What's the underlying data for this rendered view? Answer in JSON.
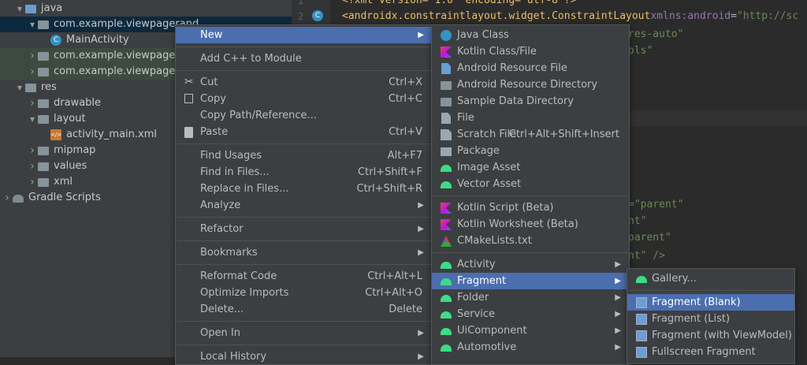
{
  "tree": [
    {
      "label": "java",
      "level": 1,
      "state": "open",
      "icon": "folder-blue",
      "row": "normal"
    },
    {
      "label": "com.example.viewpagerand...",
      "level": 2,
      "state": "open",
      "icon": "folder",
      "row": "selected"
    },
    {
      "label": "MainActivity",
      "level": 3,
      "state": "leaf",
      "icon": "class",
      "row": "normal"
    },
    {
      "label": "com.example.viewpagerand",
      "level": 2,
      "state": "closed",
      "icon": "folder",
      "row": "highlight"
    },
    {
      "label": "com.example.viewpagerand",
      "level": 2,
      "state": "closed",
      "icon": "folder",
      "row": "highlight"
    },
    {
      "label": "res",
      "level": 1,
      "state": "open",
      "icon": "folder",
      "row": "normal"
    },
    {
      "label": "drawable",
      "level": 2,
      "state": "closed",
      "icon": "folder",
      "row": "normal"
    },
    {
      "label": "layout",
      "level": 2,
      "state": "open",
      "icon": "folder",
      "row": "normal"
    },
    {
      "label": "activity_main.xml",
      "level": 3,
      "state": "leaf",
      "icon": "xml",
      "row": "normal"
    },
    {
      "label": "mipmap",
      "level": 2,
      "state": "closed",
      "icon": "folder",
      "row": "normal"
    },
    {
      "label": "values",
      "level": 2,
      "state": "closed",
      "icon": "folder",
      "row": "normal"
    },
    {
      "label": "xml",
      "level": 2,
      "state": "closed",
      "icon": "folder",
      "row": "normal"
    },
    {
      "label": "Gradle Scripts",
      "level": 0,
      "state": "closed",
      "icon": "gradle",
      "row": "normal"
    }
  ],
  "editor": {
    "line_numbers": [
      "1",
      "2"
    ],
    "line1": "<?xml version=\"1.0\" encoding=\"utf-8\"?>",
    "line2_tag": "<androidx.constraintlayout.widget.ConstraintLayout",
    "line2_attr_ns": "xmlns:",
    "line2_attr_name": "android",
    "line2_eq": "=",
    "line2_val": "\"http://sc",
    "line3": "res-auto\"",
    "line4": "ols\"",
    "line_a": "=\"parent\"",
    "line_b": "nt\"",
    "line_c": "parent\"",
    "line_d": "nt\" />"
  },
  "context_menu": {
    "items": [
      {
        "label": "New",
        "shortcut": "",
        "submenu": true,
        "active": true,
        "icon": ""
      },
      {
        "sep": true
      },
      {
        "label": "Add C++ to Module",
        "shortcut": "",
        "submenu": false,
        "icon": ""
      },
      {
        "sep": true
      },
      {
        "label": "Cut",
        "shortcut": "Ctrl+X",
        "submenu": false,
        "icon": "scissors-icon"
      },
      {
        "label": "Copy",
        "shortcut": "Ctrl+C",
        "submenu": false,
        "icon": "copy-icon"
      },
      {
        "label": "Copy Path/Reference...",
        "shortcut": "",
        "submenu": false,
        "icon": ""
      },
      {
        "label": "Paste",
        "shortcut": "Ctrl+V",
        "submenu": false,
        "icon": "clipboard-icon"
      },
      {
        "sep": true
      },
      {
        "label": "Find Usages",
        "shortcut": "Alt+F7",
        "submenu": false,
        "icon": ""
      },
      {
        "label": "Find in Files...",
        "shortcut": "Ctrl+Shift+F",
        "submenu": false,
        "icon": ""
      },
      {
        "label": "Replace in Files...",
        "shortcut": "Ctrl+Shift+R",
        "submenu": false,
        "icon": ""
      },
      {
        "label": "Analyze",
        "shortcut": "",
        "submenu": true,
        "icon": ""
      },
      {
        "sep": true
      },
      {
        "label": "Refactor",
        "shortcut": "",
        "submenu": true,
        "icon": ""
      },
      {
        "sep": true
      },
      {
        "label": "Bookmarks",
        "shortcut": "",
        "submenu": true,
        "icon": ""
      },
      {
        "sep": true
      },
      {
        "label": "Reformat Code",
        "shortcut": "Ctrl+Alt+L",
        "submenu": false,
        "icon": ""
      },
      {
        "label": "Optimize Imports",
        "shortcut": "Ctrl+Alt+O",
        "submenu": false,
        "icon": ""
      },
      {
        "label": "Delete...",
        "shortcut": "Delete",
        "submenu": false,
        "icon": ""
      },
      {
        "sep": true
      },
      {
        "label": "Open In",
        "shortcut": "",
        "submenu": true,
        "icon": ""
      },
      {
        "sep": true
      },
      {
        "label": "Local History",
        "shortcut": "",
        "submenu": true,
        "icon": ""
      }
    ]
  },
  "new_menu": {
    "items": [
      {
        "label": "Java Class",
        "shortcut": "",
        "submenu": false,
        "icon": "java-class-icon"
      },
      {
        "label": "Kotlin Class/File",
        "shortcut": "",
        "submenu": false,
        "icon": "kotlin-icon"
      },
      {
        "label": "Android Resource File",
        "shortcut": "",
        "submenu": false,
        "icon": "resource-file-icon"
      },
      {
        "label": "Android Resource Directory",
        "shortcut": "",
        "submenu": false,
        "icon": "folder-icon"
      },
      {
        "label": "Sample Data Directory",
        "shortcut": "",
        "submenu": false,
        "icon": "folder-icon"
      },
      {
        "label": "File",
        "shortcut": "",
        "submenu": false,
        "icon": "file-icon"
      },
      {
        "label": "Scratch File",
        "shortcut": "Ctrl+Alt+Shift+Insert",
        "submenu": false,
        "icon": "scratch-icon"
      },
      {
        "label": "Package",
        "shortcut": "",
        "submenu": false,
        "icon": "package-icon"
      },
      {
        "label": "Image Asset",
        "shortcut": "",
        "submenu": false,
        "icon": "android-icon"
      },
      {
        "label": "Vector Asset",
        "shortcut": "",
        "submenu": false,
        "icon": "android-icon"
      },
      {
        "sep": true
      },
      {
        "label": "Kotlin Script (Beta)",
        "shortcut": "",
        "submenu": false,
        "icon": "kotlin-icon"
      },
      {
        "label": "Kotlin Worksheet (Beta)",
        "shortcut": "",
        "submenu": false,
        "icon": "kotlin-icon"
      },
      {
        "label": "CMakeLists.txt",
        "shortcut": "",
        "submenu": false,
        "icon": "cmake-icon"
      },
      {
        "sep": true
      },
      {
        "label": "Activity",
        "shortcut": "",
        "submenu": true,
        "icon": "android-icon"
      },
      {
        "label": "Fragment",
        "shortcut": "",
        "submenu": true,
        "active": true,
        "icon": "android-icon"
      },
      {
        "label": "Folder",
        "shortcut": "",
        "submenu": true,
        "icon": "android-icon"
      },
      {
        "label": "Service",
        "shortcut": "",
        "submenu": true,
        "icon": "android-icon"
      },
      {
        "label": "UiComponent",
        "shortcut": "",
        "submenu": true,
        "icon": "android-icon"
      },
      {
        "label": "Automotive",
        "shortcut": "",
        "submenu": true,
        "icon": "android-icon"
      }
    ]
  },
  "fragment_menu": {
    "items": [
      {
        "label": "Gallery...",
        "icon": "android-icon"
      },
      {
        "sep": true
      },
      {
        "label": "Fragment (Blank)",
        "icon": "fragment-icon",
        "active": true
      },
      {
        "label": "Fragment (List)",
        "icon": "fragment-icon"
      },
      {
        "label": "Fragment (with ViewModel)",
        "icon": "fragment-icon"
      },
      {
        "label": "Fullscreen Fragment",
        "icon": "fragment-icon"
      }
    ]
  },
  "colors": {
    "accent": "#4b6eaf",
    "menu_bg": "#3c3f41",
    "editor_bg": "#2b2b2b"
  }
}
